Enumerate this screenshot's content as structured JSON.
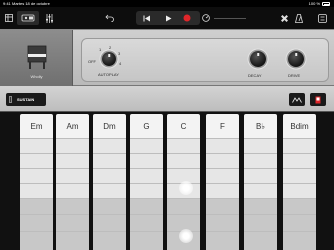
{
  "status": {
    "time": "9:41",
    "date": "Martes 18 de octubre",
    "battery": "100 %"
  },
  "toolbar": {
    "left_icons": [
      "browser-icon",
      "tracks-view-icon",
      "mixer-icon"
    ],
    "right_icons": [
      "undo-icon",
      "rewind-icon",
      "play-icon",
      "record-icon",
      "tempo-icon",
      "settings-icon",
      "metronome-icon",
      "menu-icon"
    ]
  },
  "instrument": {
    "name": "Wholly"
  },
  "controls": {
    "autoplay_label": "AUTOPLAY",
    "autoplay_off": "OFF",
    "autoplay_positions": [
      "1",
      "2",
      "3",
      "4"
    ],
    "decay_label": "DECAY",
    "drive_label": "DRIVE"
  },
  "sustain_label": "SUSTAIN",
  "chords": [
    "Em",
    "Am",
    "Dm",
    "G",
    "C",
    "F",
    "B♭",
    "Bdim"
  ],
  "colors": {
    "record": "#e0262a",
    "header": "#c4c4c4",
    "strip": "#e6e6e6"
  }
}
